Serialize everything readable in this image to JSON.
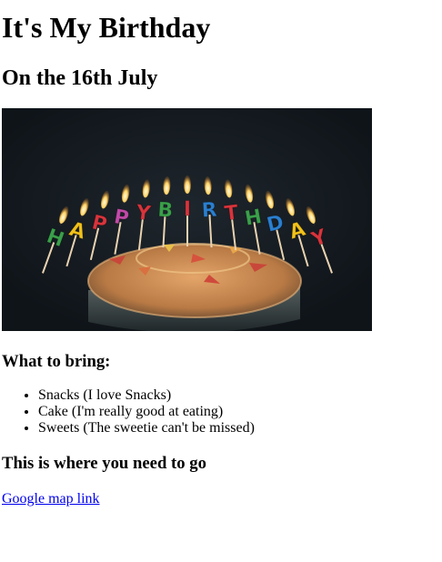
{
  "header": {
    "title": "It's My Birthday",
    "subtitle": "On the 16th July"
  },
  "image": {
    "banner_text": "HAPPY BIRTHDAY",
    "colors": {
      "background": "#141a20",
      "cake_top": "#c98a52",
      "cake_side": "#3a4448"
    },
    "letters": [
      {
        "ch": "H",
        "color": "#3aa04a"
      },
      {
        "ch": "A",
        "color": "#f2c21a"
      },
      {
        "ch": "P",
        "color": "#d9343c"
      },
      {
        "ch": "P",
        "color": "#c24aa8"
      },
      {
        "ch": "Y",
        "color": "#d9343c"
      },
      {
        "ch": "B",
        "color": "#3aa04a"
      },
      {
        "ch": "I",
        "color": "#d9343c"
      },
      {
        "ch": "R",
        "color": "#2a7fd0"
      },
      {
        "ch": "T",
        "color": "#d9343c"
      },
      {
        "ch": "H",
        "color": "#3aa04a"
      },
      {
        "ch": "D",
        "color": "#2a7fd0"
      },
      {
        "ch": "A",
        "color": "#f2c21a"
      },
      {
        "ch": "Y",
        "color": "#d9343c"
      }
    ]
  },
  "bring": {
    "heading": "What to bring:",
    "items": [
      "Snacks (I love Snacks)",
      "Cake (I'm really good at eating)",
      "Sweets (The sweetie can't be missed)"
    ]
  },
  "location": {
    "heading": "This is where you need to go",
    "link_text": "Google map link"
  }
}
